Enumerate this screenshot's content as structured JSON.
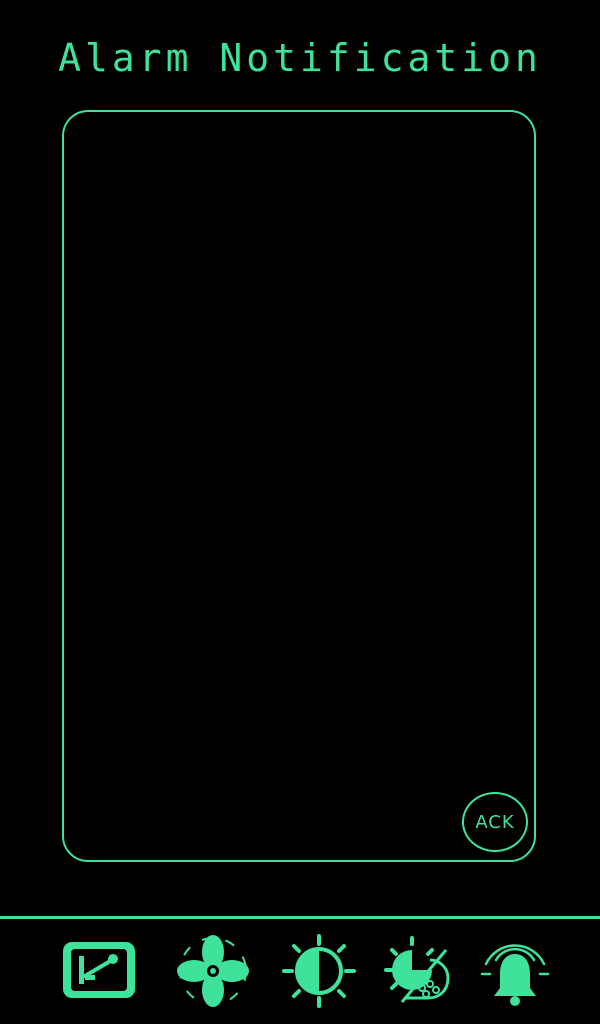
{
  "screen": {
    "title": "Alarm Notification"
  },
  "panel": {
    "ack_label": "ACK"
  },
  "nav": {
    "items": [
      {
        "icon": "lever-switch-icon"
      },
      {
        "icon": "fan-icon"
      },
      {
        "icon": "contrast-icon"
      },
      {
        "icon": "weather-sun-cloud-icon"
      },
      {
        "icon": "bell-alarm-icon"
      }
    ]
  },
  "colors": {
    "accent": "#3ee29a",
    "background": "#000000"
  }
}
